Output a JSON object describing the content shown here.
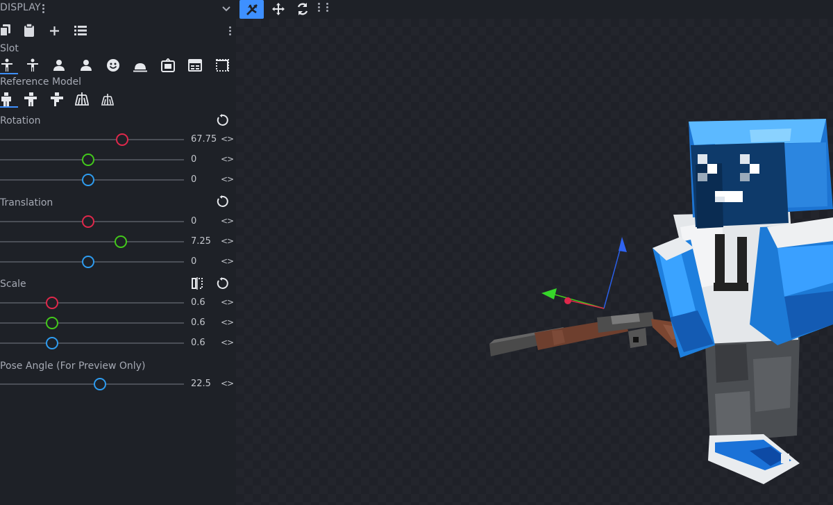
{
  "panel": {
    "title": "DISPLAY",
    "slot_label": "Slot",
    "reference_model_label": "Reference Model",
    "sections": {
      "rotation": {
        "label": "Rotation",
        "values": [
          "67.75",
          "0",
          "0"
        ]
      },
      "translation": {
        "label": "Translation",
        "values": [
          "0",
          "7.25",
          "0"
        ]
      },
      "scale": {
        "label": "Scale",
        "values": [
          "0.6",
          "0.6",
          "0.6"
        ]
      },
      "pose": {
        "label": "Pose Angle (For Preview Only)",
        "value": "22.5"
      }
    },
    "arrows": "<>"
  },
  "colors": {
    "accent": "#3e90ff",
    "x": "#e0284b",
    "y": "#43c91b",
    "z": "#2e9cf0"
  },
  "toolbar_icons": [
    "copy-icon",
    "paste-icon",
    "add-icon",
    "list-icon"
  ],
  "slot_icons": [
    "thirdperson-righthand-icon",
    "thirdperson-lefthand-icon",
    "firstperson-righthand-icon",
    "firstperson-lefthand-icon",
    "head-icon",
    "ground-icon",
    "item-frame-icon",
    "gui-icon",
    "fixed-icon"
  ],
  "model_icons": [
    "player-icon",
    "zombie-icon",
    "armor-stand-icon",
    "armor-stand-small-icon",
    "armor-stand-alt-icon"
  ],
  "viewport_tools": [
    "gizmo-icon",
    "move-icon",
    "rotate-icon"
  ]
}
